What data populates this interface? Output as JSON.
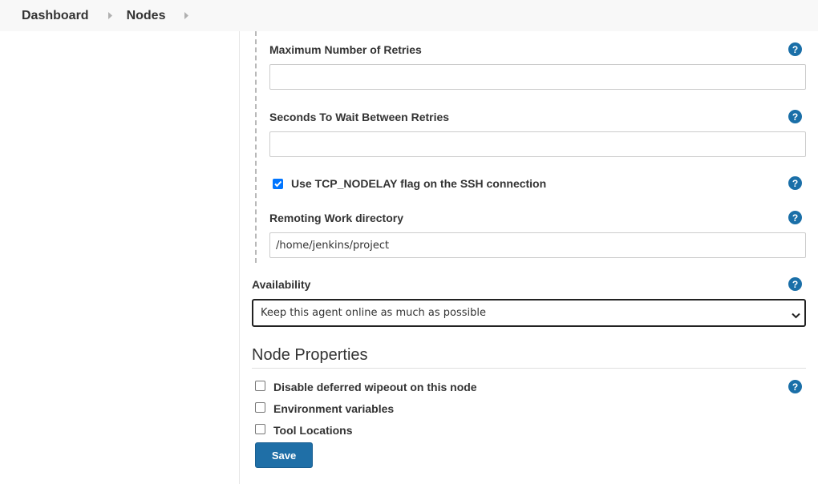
{
  "breadcrumb": {
    "items": [
      {
        "label": "Dashboard"
      },
      {
        "label": "Nodes"
      }
    ]
  },
  "form": {
    "max_retries": {
      "label": "Maximum Number of Retries",
      "value": ""
    },
    "retry_wait": {
      "label": "Seconds To Wait Between Retries",
      "value": ""
    },
    "tcp_nodelay": {
      "label": "Use TCP_NODELAY flag on the SSH connection",
      "checked": true
    },
    "work_dir": {
      "label": "Remoting Work directory",
      "value": "/home/jenkins/project"
    },
    "availability": {
      "label": "Availability",
      "selected": "Keep this agent online as much as possible"
    },
    "help_glyph": "?"
  },
  "node_properties": {
    "title": "Node Properties",
    "items": [
      {
        "label": "Disable deferred wipeout on this node",
        "checked": false
      },
      {
        "label": "Environment variables",
        "checked": false
      },
      {
        "label": "Tool Locations",
        "checked": false
      }
    ]
  },
  "actions": {
    "save_label": "Save"
  },
  "colors": {
    "help_icon": "#1a6fa8",
    "save_button": "#1f6fa7",
    "checkbox_checked": "#0075ff"
  }
}
